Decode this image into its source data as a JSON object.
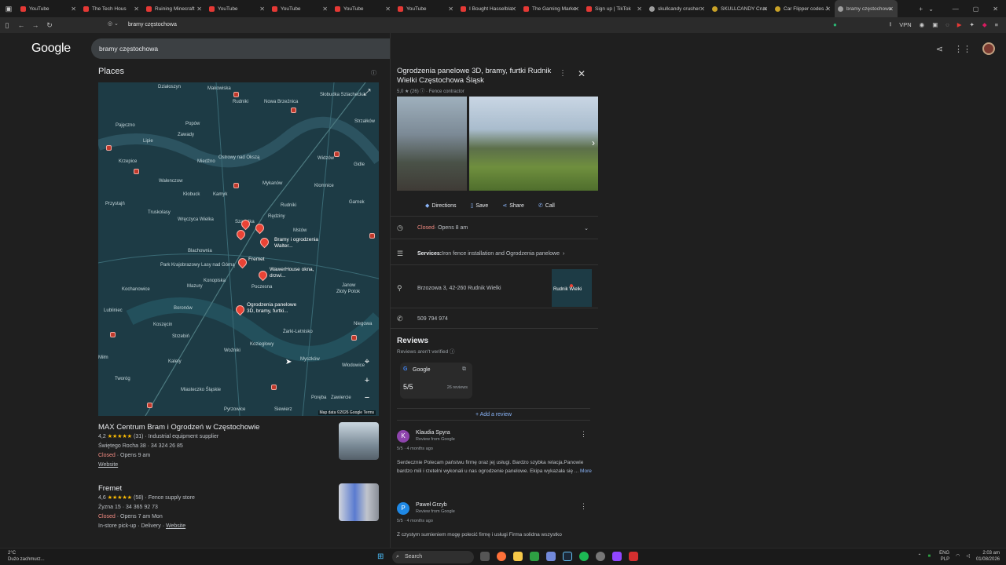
{
  "browser": {
    "tabs": [
      {
        "title": "YouTube",
        "icon": "youtube-icon"
      },
      {
        "title": "The Tech Hous",
        "icon": "youtube-icon"
      },
      {
        "title": "Ruining Minecraft",
        "icon": "youtube-icon"
      },
      {
        "title": "YouTube",
        "icon": "youtube-icon"
      },
      {
        "title": "YouTube",
        "icon": "youtube-icon"
      },
      {
        "title": "YouTube",
        "icon": "youtube-icon"
      },
      {
        "title": "YouTube",
        "icon": "youtube-icon"
      },
      {
        "title": "I Bought Hasselbla",
        "icon": "youtube-icon"
      },
      {
        "title": "The Gaming Marke",
        "icon": "youtube-icon"
      },
      {
        "title": "Sign up | TikTok",
        "icon": "tiktok-icon"
      },
      {
        "title": "skullcandy crusher",
        "icon": "google-icon"
      },
      {
        "title": "SKULLCANDY Crus",
        "icon": "site-icon"
      },
      {
        "title": "Car Flipper codes J",
        "icon": "site-icon"
      },
      {
        "title": "bramy częstochowa",
        "icon": "google-icon"
      }
    ],
    "url": "bramy częstochowa",
    "vpn_label": "VPN"
  },
  "google": {
    "logo": "Google",
    "query": "bramy częstochowa"
  },
  "places": {
    "heading": "Places",
    "map_labels": [
      "Działoszyn",
      "Makowiska",
      "Rudniki",
      "Nowa Brzeźnica",
      "Słobudka Szlachecka",
      "Strzałków",
      "Pajęczno",
      "Popów",
      "Zawady",
      "Lipie",
      "Ostrowy nad Okszą",
      "Widzów",
      "Gidle",
      "Krzepice",
      "Miedźno",
      "Walenczow",
      "Mykanów",
      "Kłomnice",
      "Kłobuck",
      "Kamyk",
      "Przystajń",
      "Rudniki",
      "Garnek",
      "Truskolasy",
      "Rędziny",
      "Wręczyca Wielka",
      "Szarlejka",
      "Mstów",
      "Blachownia",
      "Park Krajobrazowy Lasy nad Górną",
      "Konopiska",
      "Poczesna",
      "Kochanowice",
      "Mazury",
      "Janow",
      "Złoty Potok",
      "Boronów",
      "Lubliniec",
      "Koszęcin",
      "Niegowa",
      "Strzebiń",
      "Żarki-Letnisko",
      "Koziegłowy",
      "Woźniki",
      "Myszków",
      "Kalety",
      "Włodowice",
      "Miłm",
      "Tworóg",
      "Miasteczko Śląskie",
      "Pyrzowice",
      "Siewierz",
      "Poręba",
      "Zawiercie"
    ],
    "pins": [
      {
        "label": "Bramy i ogrodzenia Walter..."
      },
      {
        "label": "Fremet"
      },
      {
        "label": "WawerHouse okna, drzwi..."
      },
      {
        "label": "Ogrodzenia panelowe 3D, bramy, furtki..."
      }
    ],
    "map_credit": "Map data ©2026 Google",
    "map_terms": "Terms",
    "results": [
      {
        "name": "MAX Centrum Bram i Ogrodzeń w Częstochowie",
        "rating": "4,2",
        "stars": "★★★★★",
        "reviews": "(31)",
        "category": "Industrial equipment supplier",
        "address": "Świętego Rocha 38 · 34 324 26 85",
        "status": "Closed",
        "hours": "· Opens 9 am",
        "link": "Website"
      },
      {
        "name": "Fremet",
        "rating": "4,6",
        "stars": "★★★★★",
        "reviews": "(58)",
        "category": "Fence supply store",
        "address": "Żyzna 15 · 34 365 92 73",
        "status": "Closed",
        "hours": "· Opens 7 am Mon",
        "extra": "In-store pick-up · Delivery",
        "link": "Website"
      }
    ]
  },
  "detail": {
    "title": "Ogrodzenia panelowe 3D, bramy, furtki Rudnik Wielki Częstochowa Śląsk",
    "rating_line": "5,0 ★ (26) ⓘ · Fence contractor",
    "actions": [
      {
        "label": "Directions",
        "icon": "directions-icon"
      },
      {
        "label": "Save",
        "icon": "bookmark-icon"
      },
      {
        "label": "Share",
        "icon": "share-icon"
      },
      {
        "label": "Call",
        "icon": "phone-icon"
      }
    ],
    "hours_status": "Closed",
    "hours_text": " · Opens 8 am",
    "services_label": "Services:",
    "services_text": " Iron fence installation and Ogrodzenia panelowe",
    "address": "Brzozowa 3, 42-260 Rudnik Wielki",
    "mini_map_label": "Rudnik Wielki",
    "phone": "509 794 974",
    "reviews_heading": "Reviews",
    "reviews_verified": "Reviews aren't verified ⓘ",
    "source_name": "Google",
    "source_score": "5/5",
    "source_count": "26 reviews",
    "add_review": "Add a review",
    "reviews": [
      {
        "initial": "K",
        "color": "#8e44ad",
        "author": "Klaudia Spyra",
        "source": "Review from Google",
        "score": "5/5",
        "when": "· 4 months ago",
        "text": "Serdecznie Polecam państwu firmę oraz jej usługi. Bardzo szybka relacja.Panowie bardzo mili i rzetelni wykonali u nas ogrodzenie panelowe. Ekipa wykazała się ...",
        "more": "More"
      },
      {
        "initial": "P",
        "color": "#1e88e5",
        "author": "Paweł Grzyb",
        "source": "Review from Google",
        "score": "5/5",
        "when": "· 4 months ago",
        "text": "Z czystym sumieniem mogę polecić firmę i usługi Firma solidna wszystko"
      }
    ]
  },
  "taskbar": {
    "weather_temp": "2°C",
    "weather_desc": "Dużo zachmurz...",
    "search_label": "Search",
    "lang": "ENG PLP",
    "time": "2:03 am",
    "date": "01/08/2026"
  }
}
